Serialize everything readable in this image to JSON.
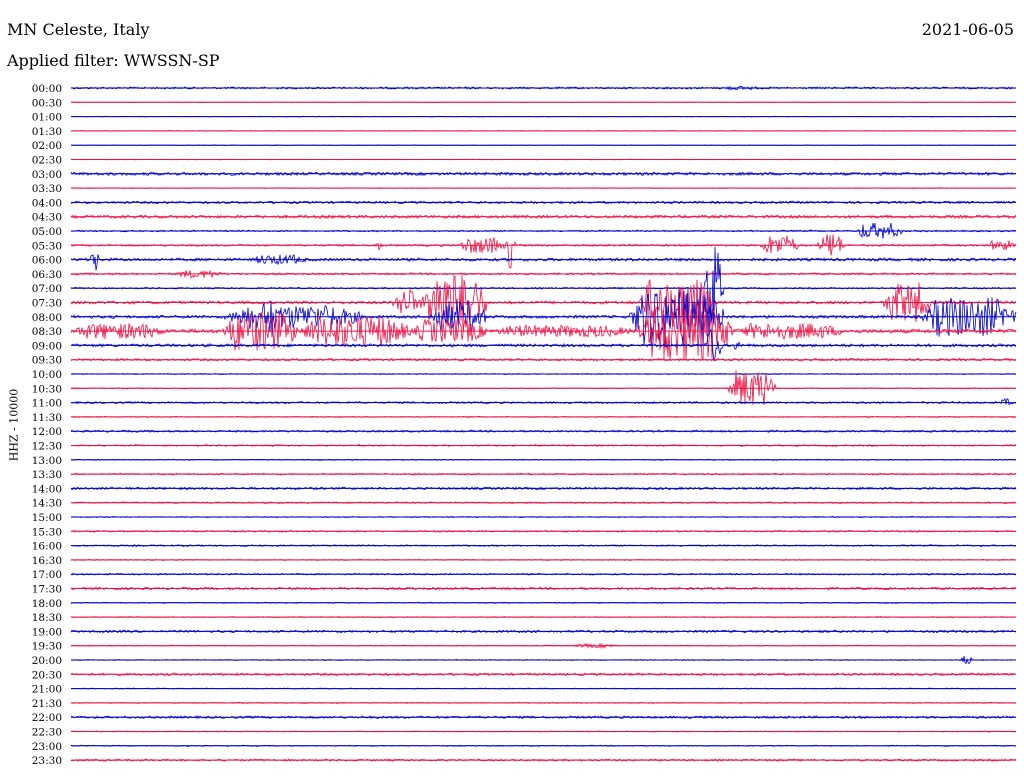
{
  "header": {
    "station": "MN Celeste, Italy",
    "date": "2021-06-05",
    "filter": "Applied filter: WWSSN-SP"
  },
  "chart_data": {
    "type": "line",
    "title": "MN Celeste, Italy",
    "ylabel": "HHZ - 10000",
    "colors": {
      "even": "#0000cc",
      "odd": "#ee1144"
    },
    "trace_rows": [
      "00:00",
      "00:30",
      "01:00",
      "01:30",
      "02:00",
      "02:30",
      "03:00",
      "03:30",
      "04:00",
      "04:30",
      "05:00",
      "05:30",
      "06:00",
      "06:30",
      "07:00",
      "07:30",
      "08:00",
      "08:30",
      "09:00",
      "09:30",
      "10:00",
      "10:30",
      "11:00",
      "11:30",
      "12:00",
      "12:30",
      "13:00",
      "13:30",
      "14:00",
      "14:30",
      "15:00",
      "15:30",
      "16:00",
      "16:30",
      "17:00",
      "17:30",
      "18:00",
      "18:30",
      "19:00",
      "19:30",
      "20:00",
      "20:30",
      "21:00",
      "21:30",
      "22:00",
      "22:30",
      "23:00",
      "23:30"
    ],
    "background_noise": [
      1,
      0.3,
      0.3,
      0.3,
      0.3,
      0.3,
      1.5,
      0.3,
      1.2,
      1.5,
      0.8,
      1,
      1.5,
      1,
      0.8,
      1.5,
      1.5,
      2,
      1.5,
      1.2,
      0.5,
      0.5,
      1,
      0.5,
      1,
      0.8,
      0.5,
      0.8,
      1.2,
      0.8,
      0.5,
      0.8,
      0.8,
      0.5,
      0.8,
      1.2,
      0.5,
      0.5,
      1.2,
      0.5,
      0.5,
      1.2,
      0.5,
      0.5,
      1.2,
      0.5,
      0.5,
      1
    ],
    "events": [
      {
        "row": "00:00",
        "start": 0.69,
        "end": 0.73,
        "amp": 2
      },
      {
        "row": "05:00",
        "start": 0.83,
        "end": 0.88,
        "amp": 8
      },
      {
        "row": "05:30",
        "start": 0.32,
        "end": 0.33,
        "amp": 5
      },
      {
        "row": "05:30",
        "start": 0.41,
        "end": 0.46,
        "amp": 8
      },
      {
        "row": "05:30",
        "start": 0.46,
        "end": 0.47,
        "amp": 25
      },
      {
        "row": "05:30",
        "start": 0.73,
        "end": 0.77,
        "amp": 10
      },
      {
        "row": "05:30",
        "start": 0.79,
        "end": 0.82,
        "amp": 14
      },
      {
        "row": "05:30",
        "start": 0.97,
        "end": 1.0,
        "amp": 5
      },
      {
        "row": "06:00",
        "start": 0.02,
        "end": 0.03,
        "amp": 14
      },
      {
        "row": "06:00",
        "start": 0.19,
        "end": 0.25,
        "amp": 5
      },
      {
        "row": "06:30",
        "start": 0.11,
        "end": 0.16,
        "amp": 4
      },
      {
        "row": "07:00",
        "start": 0.67,
        "end": 0.69,
        "amp": 50
      },
      {
        "row": "07:30",
        "start": 0.34,
        "end": 0.37,
        "amp": 16
      },
      {
        "row": "07:30",
        "start": 0.37,
        "end": 0.44,
        "amp": 30
      },
      {
        "row": "07:30",
        "start": 0.6,
        "end": 0.68,
        "amp": 26
      },
      {
        "row": "07:30",
        "start": 0.86,
        "end": 0.91,
        "amp": 20
      },
      {
        "row": "08:00",
        "start": 0.16,
        "end": 0.31,
        "amp": 12
      },
      {
        "row": "08:00",
        "start": 0.2,
        "end": 0.22,
        "amp": 25
      },
      {
        "row": "08:00",
        "start": 0.38,
        "end": 0.44,
        "amp": 16
      },
      {
        "row": "08:00",
        "start": 0.59,
        "end": 0.69,
        "amp": 30
      },
      {
        "row": "08:00",
        "start": 0.9,
        "end": 1.0,
        "amp": 20
      },
      {
        "row": "08:30",
        "start": 0.0,
        "end": 0.1,
        "amp": 8
      },
      {
        "row": "08:30",
        "start": 0.16,
        "end": 0.24,
        "amp": 20
      },
      {
        "row": "08:30",
        "start": 0.24,
        "end": 0.36,
        "amp": 16
      },
      {
        "row": "08:30",
        "start": 0.36,
        "end": 0.44,
        "amp": 12
      },
      {
        "row": "08:30",
        "start": 0.44,
        "end": 0.6,
        "amp": 6
      },
      {
        "row": "08:30",
        "start": 0.6,
        "end": 0.7,
        "amp": 30
      },
      {
        "row": "08:30",
        "start": 0.7,
        "end": 0.82,
        "amp": 8
      },
      {
        "row": "09:00",
        "start": 0.67,
        "end": 0.69,
        "amp": 20
      },
      {
        "row": "09:00",
        "start": 0.7,
        "end": 0.71,
        "amp": 6
      },
      {
        "row": "10:30",
        "start": 0.695,
        "end": 0.745,
        "amp": 18
      },
      {
        "row": "11:00",
        "start": 0.98,
        "end": 1.0,
        "amp": 4
      },
      {
        "row": "19:30",
        "start": 0.53,
        "end": 0.58,
        "amp": 2
      },
      {
        "row": "20:00",
        "start": 0.94,
        "end": 0.955,
        "amp": 5
      }
    ]
  }
}
